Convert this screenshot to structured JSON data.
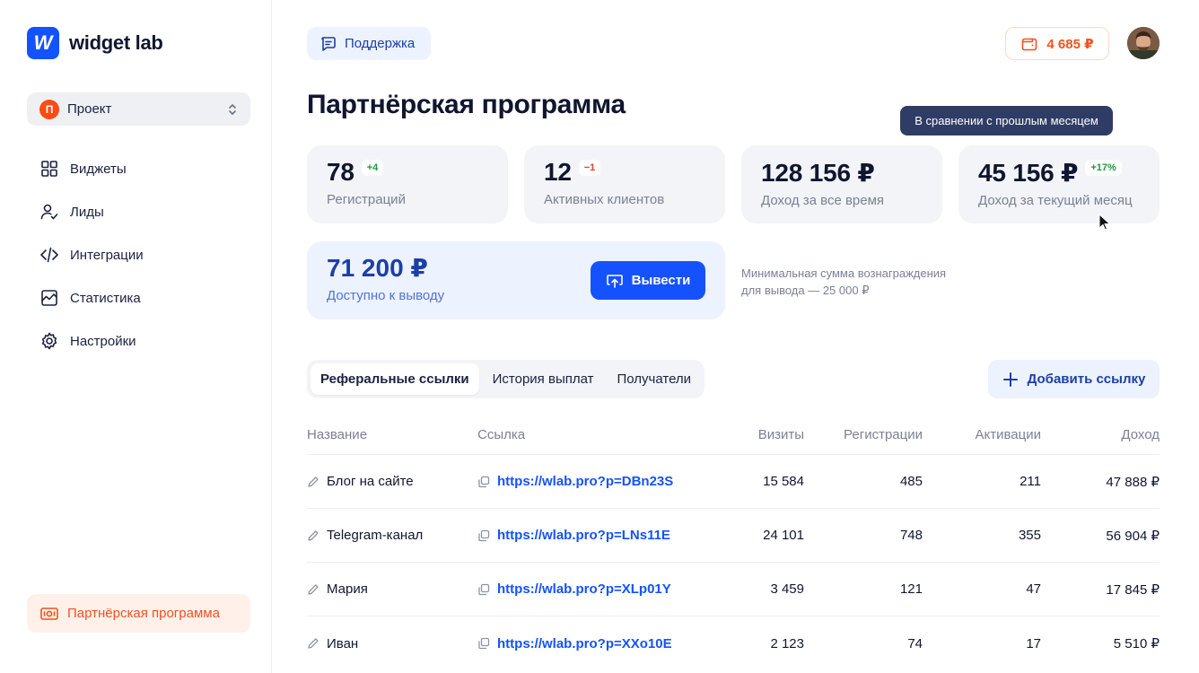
{
  "brand": {
    "logo_letter": "W",
    "name": "widget lab",
    "color": "#1452ff"
  },
  "project": {
    "badge": "П",
    "label": "Проект"
  },
  "sidebar": {
    "items": [
      {
        "label": "Виджеты",
        "icon": "grid-icon"
      },
      {
        "label": "Лиды",
        "icon": "user-check-icon"
      },
      {
        "label": "Интеграции",
        "icon": "code-icon"
      },
      {
        "label": "Статистика",
        "icon": "chart-icon"
      },
      {
        "label": "Настройки",
        "icon": "gear-icon"
      }
    ],
    "partner": {
      "label": "Партнёрская программа",
      "icon": "partner-icon",
      "color": "#f4511e"
    }
  },
  "header": {
    "support_label": "Поддержка",
    "balance": "4 685 ₽"
  },
  "page_title": "Партнёрская программа",
  "tooltip": "В сравнении с прошлым месяцем",
  "stats": [
    {
      "value": "78",
      "delta": "+4",
      "label": "Регистраций",
      "trend": "positive"
    },
    {
      "value": "12",
      "delta": "−1",
      "label": "Активных клиентов",
      "trend": "negative"
    },
    {
      "value": "128 156 ₽",
      "delta": "",
      "label": "Доход за все время",
      "trend": ""
    },
    {
      "value": "45 156 ₽",
      "delta": "+17%",
      "label": "Доход за текущий месяц",
      "trend": "positive"
    }
  ],
  "withdraw": {
    "value": "71 200 ₽",
    "label": "Доступно к выводу",
    "button_label": "Вывести",
    "note_line1": "Минимальная сумма вознаграждения",
    "note_line2": "для вывода — 25 000 ₽"
  },
  "tabs": [
    {
      "label": "Реферальные ссылки",
      "active": true
    },
    {
      "label": "История выплат",
      "active": false
    },
    {
      "label": "Получатели",
      "active": false
    }
  ],
  "add_link_label": "Добавить ссылку",
  "table": {
    "columns": [
      "Название",
      "Ссылка",
      "Визиты",
      "Регистрации",
      "Активации",
      "Доход"
    ],
    "rows": [
      {
        "name": "Блог на сайте",
        "link": "https://wlab.pro?p=DBn23S",
        "visits": "15 584",
        "registrations": "485",
        "activations": "211",
        "income": "47 888 ₽"
      },
      {
        "name": "Telegram-канал",
        "link": "https://wlab.pro?p=LNs11E",
        "visits": "24 101",
        "registrations": "748",
        "activations": "355",
        "income": "56 904 ₽"
      },
      {
        "name": "Мария",
        "link": "https://wlab.pro?p=XLp01Y",
        "visits": "3 459",
        "registrations": "121",
        "activations": "47",
        "income": "17 845 ₽"
      },
      {
        "name": "Иван",
        "link": "https://wlab.pro?p=XXo10E",
        "visits": "2 123",
        "registrations": "74",
        "activations": "17",
        "income": "5 510 ₽"
      }
    ]
  }
}
